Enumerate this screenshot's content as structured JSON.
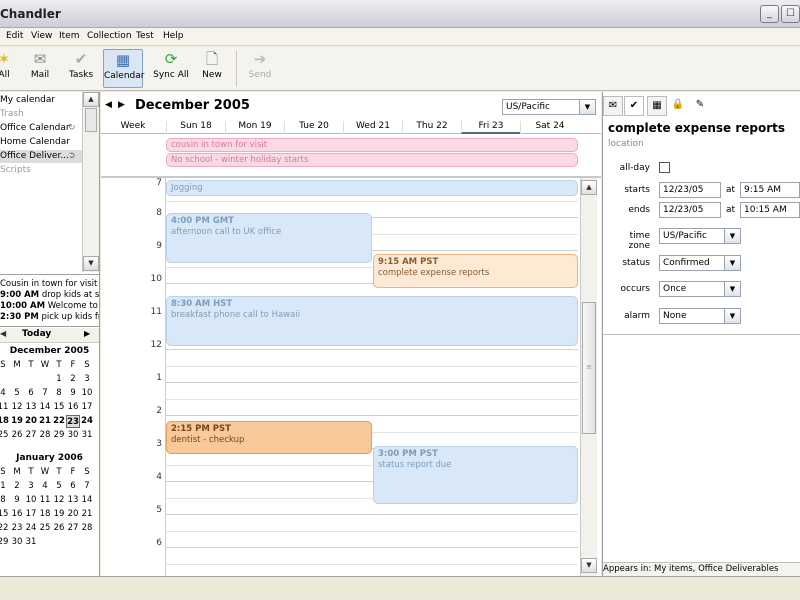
{
  "window": {
    "title": "Chandler",
    "minimize": "_",
    "maximize": "☐"
  },
  "menu": [
    "Edit",
    "View",
    "Item",
    "Collection",
    "Test",
    "Help"
  ],
  "toolbar": {
    "all": "All",
    "mail": "Mail",
    "tasks": "Tasks",
    "calendar": "Calendar",
    "sync_all": "Sync All",
    "new": "New",
    "send": "Send"
  },
  "sidebar": {
    "collections": [
      "My calendar",
      "Trash",
      "Office Calendar",
      "Home Calendar",
      "Office Deliver...",
      "Scripts"
    ],
    "preview": [
      {
        "time": "",
        "text": "Cousin in town for visit"
      },
      {
        "time": "9:00 AM",
        "text": "drop kids at school"
      },
      {
        "time": "10:00 AM",
        "text": "Welcome to Chandler"
      },
      {
        "time": "2:30 PM",
        "text": "pick up kids from"
      }
    ],
    "today_button": "Today",
    "next_arrow": "▶",
    "minical": [
      {
        "month": "December 2005",
        "dow": [
          "S",
          "M",
          "T",
          "W",
          "T",
          "F",
          "S"
        ],
        "weeks": [
          [
            "",
            "",
            "",
            "",
            "1",
            "2",
            "3"
          ],
          [
            "4",
            "5",
            "6",
            "7",
            "8",
            "9",
            "10"
          ],
          [
            "11",
            "12",
            "13",
            "14",
            "15",
            "16",
            "17"
          ],
          [
            "18",
            "19",
            "20",
            "21",
            "22",
            "23",
            "24"
          ],
          [
            "25",
            "26",
            "27",
            "28",
            "29",
            "30",
            "31"
          ]
        ]
      },
      {
        "month": "January 2006",
        "dow": [
          "S",
          "M",
          "T",
          "W",
          "T",
          "F",
          "S"
        ],
        "weeks": [
          [
            "1",
            "2",
            "3",
            "4",
            "5",
            "6",
            "7"
          ],
          [
            "8",
            "9",
            "10",
            "11",
            "12",
            "13",
            "14"
          ],
          [
            "15",
            "16",
            "17",
            "18",
            "19",
            "20",
            "21"
          ],
          [
            "22",
            "23",
            "24",
            "25",
            "26",
            "27",
            "28"
          ],
          [
            "29",
            "30",
            "31",
            "",
            "",
            "",
            ""
          ]
        ]
      }
    ]
  },
  "calendar": {
    "month_title": "December 2005",
    "timezone": "US/Pacific",
    "week_label": "Week",
    "days": [
      "Sun 18",
      "Mon 19",
      "Tue 20",
      "Wed 21",
      "Thu 22",
      "Fri 23",
      "Sat 24"
    ],
    "allday_events": [
      "cousin in town for visit",
      "No school - winter holiday starts"
    ],
    "hours": [
      "7",
      "8",
      "9",
      "10",
      "11",
      "12",
      "1",
      "2",
      "3",
      "4",
      "5",
      "6"
    ],
    "events": [
      {
        "time": "",
        "title": "Jogging"
      },
      {
        "time": "4:00 PM GMT",
        "title": "afternoon call to UK office"
      },
      {
        "time": "9:15 AM PST",
        "title": "complete expense reports"
      },
      {
        "time": "8:30 AM HST",
        "title": "breakfast phone call to Hawaii"
      },
      {
        "time": "2:15 PM PST",
        "title": "dentist - checkup"
      },
      {
        "time": "3:00 PM PST",
        "title": "status report due"
      }
    ]
  },
  "detail": {
    "title": "complete expense reports",
    "location_placeholder": "location",
    "labels": {
      "allday": "all-day",
      "starts": "starts",
      "ends": "ends",
      "at": "at",
      "timezone": "time zone",
      "status": "status",
      "occurs": "occurs",
      "alarm": "alarm"
    },
    "start_date": "12/23/05",
    "start_time": "9:15 AM",
    "end_date": "12/23/05",
    "end_time": "10:15 AM",
    "timezone": "US/Pacific",
    "status": "Confirmed",
    "occurs": "Once",
    "alarm": "None",
    "appears_in": "Appears in: My items, Office Deliverables"
  },
  "colors": {
    "event_blue": "#d9e8f8",
    "event_orange": "#fde9d4",
    "allday_pink": "#fcd9e6"
  }
}
